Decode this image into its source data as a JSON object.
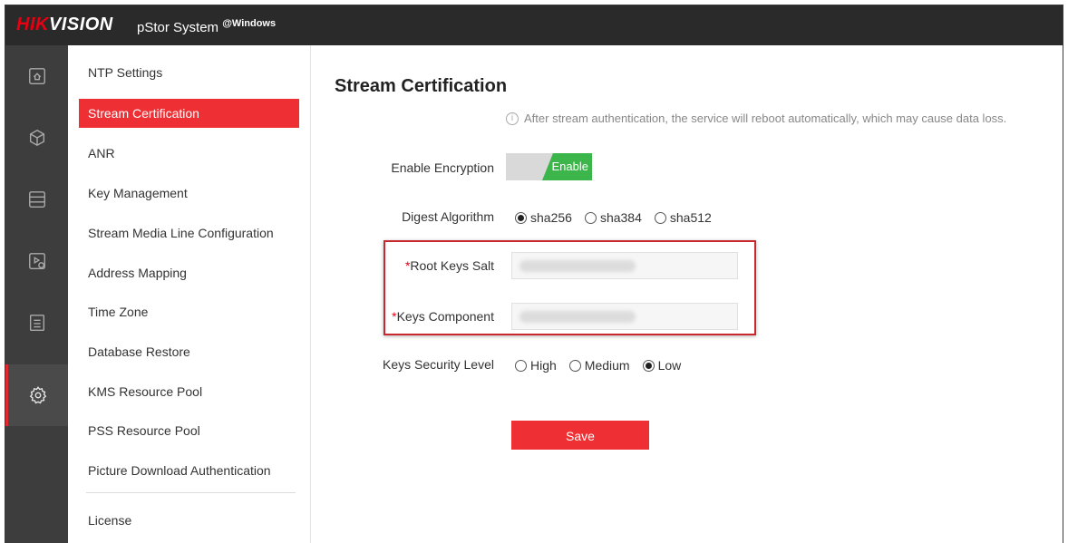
{
  "header": {
    "brand_red": "HIK",
    "brand_white": "VISION",
    "product": "pStor System",
    "product_suffix": "@Windows"
  },
  "rail": [
    {
      "icon": "home-icon"
    },
    {
      "icon": "cube-icon"
    },
    {
      "icon": "storage-icon"
    },
    {
      "icon": "video-record-icon"
    },
    {
      "icon": "log-list-icon"
    },
    {
      "icon": "settings-gear-icon",
      "active": true
    }
  ],
  "menu": {
    "items": [
      {
        "label": "NTP Settings"
      },
      {
        "label": "Stream Certification",
        "active": true
      },
      {
        "label": "ANR"
      },
      {
        "label": "Key Management"
      },
      {
        "label": "Stream Media Line Configuration"
      },
      {
        "label": "Address Mapping"
      },
      {
        "label": "Time Zone"
      },
      {
        "label": "Database Restore"
      },
      {
        "label": "KMS Resource Pool"
      },
      {
        "label": "PSS Resource Pool"
      },
      {
        "label": "Picture Download Authentication"
      },
      {
        "label": "License"
      }
    ]
  },
  "main": {
    "title": "Stream Certification",
    "notice": "After stream authentication, the service will reboot automatically, which may cause data loss.",
    "enable_encryption": {
      "label": "Enable Encryption",
      "toggle_text": "Enable",
      "value": true
    },
    "digest_algorithm": {
      "label": "Digest Algorithm",
      "options": [
        "sha256",
        "sha384",
        "sha512"
      ],
      "selected": "sha256"
    },
    "root_keys_salt": {
      "label": "Root Keys Salt",
      "required_mark": "*"
    },
    "keys_component": {
      "label": "Keys Component",
      "required_mark": "*"
    },
    "keys_security_level": {
      "label": "Keys Security Level",
      "options": [
        "High",
        "Medium",
        "Low"
      ],
      "selected": "Low"
    },
    "save_label": "Save"
  },
  "colors": {
    "accent_red": "#ee2f34",
    "toggle_green": "#3cb54a",
    "header_bg": "#2a2a2a",
    "rail_bg": "#3d3d3d"
  }
}
